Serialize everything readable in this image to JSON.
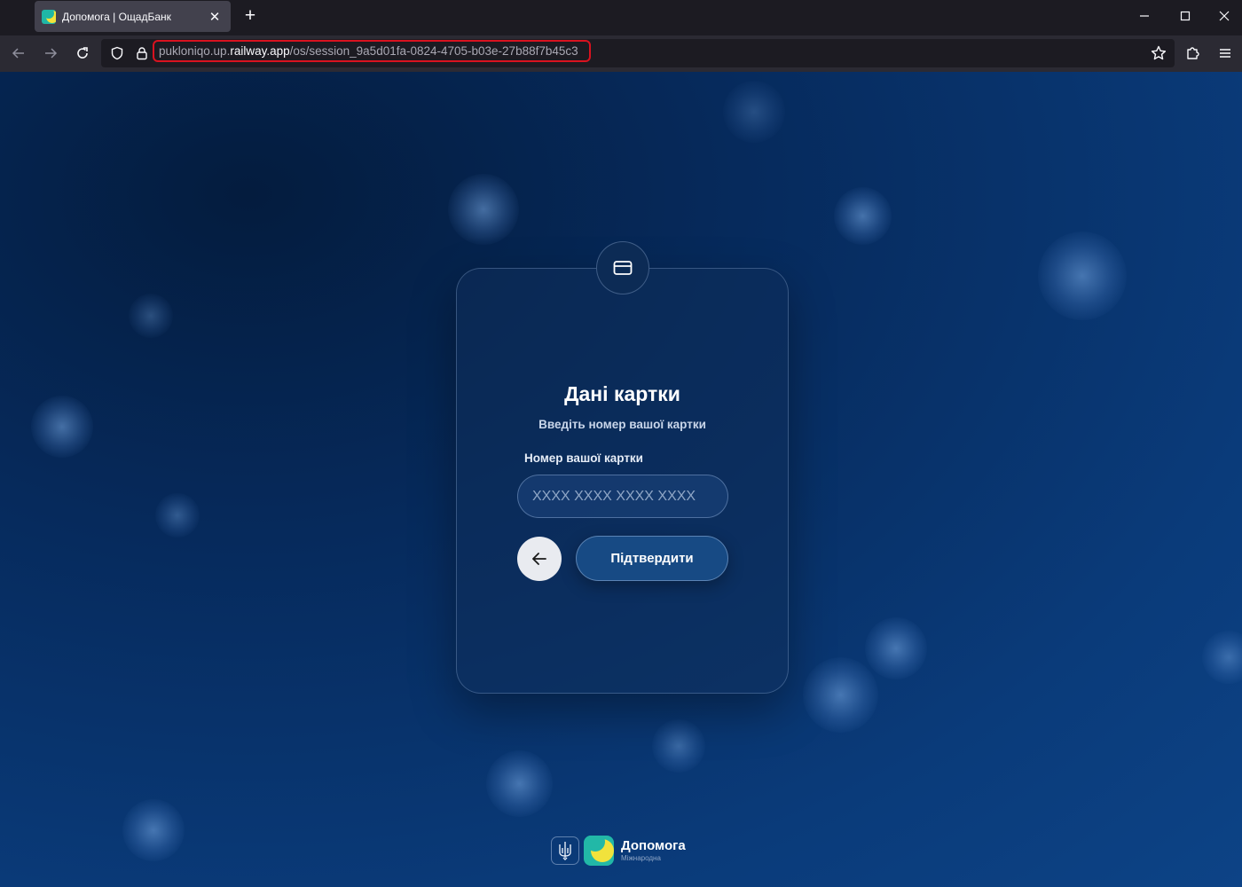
{
  "browser": {
    "tab_title": "Допомога | ОщадБанк",
    "tab_close": "✕",
    "new_tab": "+",
    "url_host_prefix": "pukloniqo.up.",
    "url_host_domain": "railway.app",
    "url_path": "/os/session_9a5d01fa-0824-4705-b03e-27b88f7b45c3",
    "highlight_color": "#d9121f"
  },
  "card": {
    "icon": "credit-card-icon",
    "title": "Дані картки",
    "subtitle": "Введіть номер вашої картки",
    "field_label": "Номер вашої картки",
    "card_input_placeholder": "XXXX XXXX XXXX XXXX",
    "card_input_value": "",
    "back_icon": "arrow-left-icon",
    "confirm_label": "Підтвердити"
  },
  "footer": {
    "emblem_icon": "trident-icon",
    "brand_name": "Допомога",
    "brand_sub": "Міжнародна"
  },
  "colors": {
    "background": "#0a3b7a",
    "card": "#0f2d5a",
    "button": "#174a84",
    "brand_teal": "#22b8a7",
    "brand_yellow": "#f1e23c"
  }
}
